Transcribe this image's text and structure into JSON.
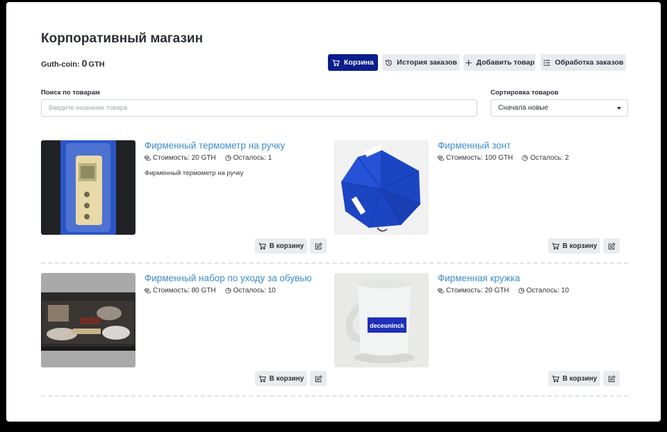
{
  "page": {
    "title": "Корпоративный магазин",
    "coin_label": "Guth-coin:",
    "coin_amount": "0",
    "coin_unit": "GTH"
  },
  "toolbar": {
    "cart_label": "Корзина",
    "history_label": "История заказов",
    "add_label": "Добавить товар",
    "process_label": "Обработка заказов"
  },
  "search": {
    "label": "Поиск по товарам",
    "placeholder": "Введите название товара",
    "value": ""
  },
  "sort": {
    "label": "Сортировка товаров",
    "selected": "Сначала новые"
  },
  "products": [
    {
      "name": "Фирменный термометр на ручку",
      "price": "Стоимость: 20 GTH",
      "stock": "Осталось: 1",
      "description": "Фирменный термометр на ручку",
      "cart_label": "В корзину"
    },
    {
      "name": "Фирменный зонт",
      "price": "Стоимость: 100 GTH",
      "stock": "Осталось: 2",
      "description": "",
      "cart_label": "В корзину"
    },
    {
      "name": "Фирменный набор по уходу за обувью",
      "price": "Стоимость: 80 GTH",
      "stock": "Осталось: 10",
      "description": "",
      "cart_label": "В корзину"
    },
    {
      "name": "Фирменная кружка",
      "price": "Стоимость: 20 GTH",
      "stock": "Осталось: 10",
      "description": "",
      "cart_label": "В корзину",
      "mug_brand": "deceuninck"
    }
  ],
  "colors": {
    "primary": "#0b1e8c",
    "link": "#3d8bc9",
    "button_bg": "#e9ecef"
  }
}
